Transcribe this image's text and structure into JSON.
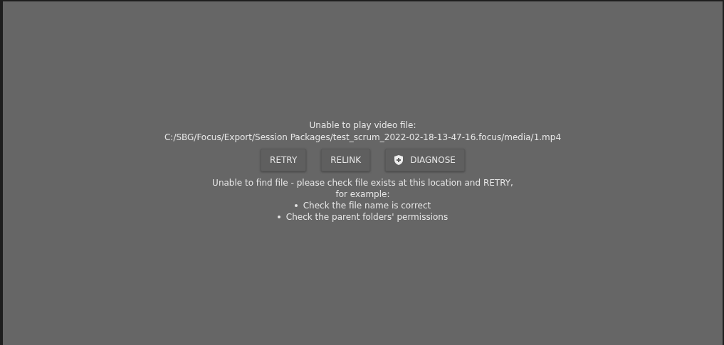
{
  "error": {
    "title": "Unable to play video file:",
    "path": "C:/SBG/Focus/Export/Session Packages/test_scrum_2022-02-18-13-47-16.focus/media/1.mp4",
    "buttons": [
      {
        "label": "RETRY",
        "kind": "plain"
      },
      {
        "label": "RELINK",
        "kind": "plain"
      },
      {
        "label": "DIAGNOSE",
        "kind": "shield"
      }
    ],
    "message": "Unable to find file - please check file exists at this location and RETRY, for example:",
    "hints": [
      "Check the file name is correct",
      "Check the parent folders' permissions"
    ]
  }
}
